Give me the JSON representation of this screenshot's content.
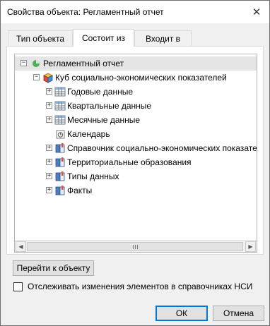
{
  "window": {
    "title": "Свойства объекта: Регламентный отчет",
    "close_glyph": "✕"
  },
  "tabs": [
    {
      "label": "Тип объекта",
      "active": false
    },
    {
      "label": "Состоит из",
      "active": true
    },
    {
      "label": "Входит в",
      "active": false
    }
  ],
  "tree": {
    "root": {
      "label": "Регламентный отчет",
      "icon": "report-icon",
      "expander": "−"
    },
    "cube": {
      "label": "Куб социально-экономических показателей",
      "icon": "cube-icon",
      "expander": "−"
    },
    "children": [
      {
        "label": "Годовые данные",
        "icon": "table-icon",
        "expander": "+"
      },
      {
        "label": "Квартальные данные",
        "icon": "table-icon",
        "expander": "+"
      },
      {
        "label": "Месячные данные",
        "icon": "table-icon",
        "expander": "+"
      },
      {
        "label": "Календарь",
        "icon": "calendar-icon",
        "expander": ""
      },
      {
        "label": "Справочник социально-экономических показателей",
        "icon": "dictionary-icon",
        "expander": "+"
      },
      {
        "label": "Территориальные образования",
        "icon": "dictionary-icon",
        "expander": "+"
      },
      {
        "label": "Типы данных",
        "icon": "dictionary-icon",
        "expander": "+"
      },
      {
        "label": "Факты",
        "icon": "dictionary-icon",
        "expander": "+"
      }
    ]
  },
  "scrollbar": {
    "left_arrow": "◀",
    "right_arrow": "▶"
  },
  "buttons": {
    "goto": "Перейти к объекту",
    "ok": "ОК",
    "cancel": "Отмена"
  },
  "tracking": {
    "label": "Отслеживать изменения элементов в справочниках НСИ",
    "checked": false
  }
}
